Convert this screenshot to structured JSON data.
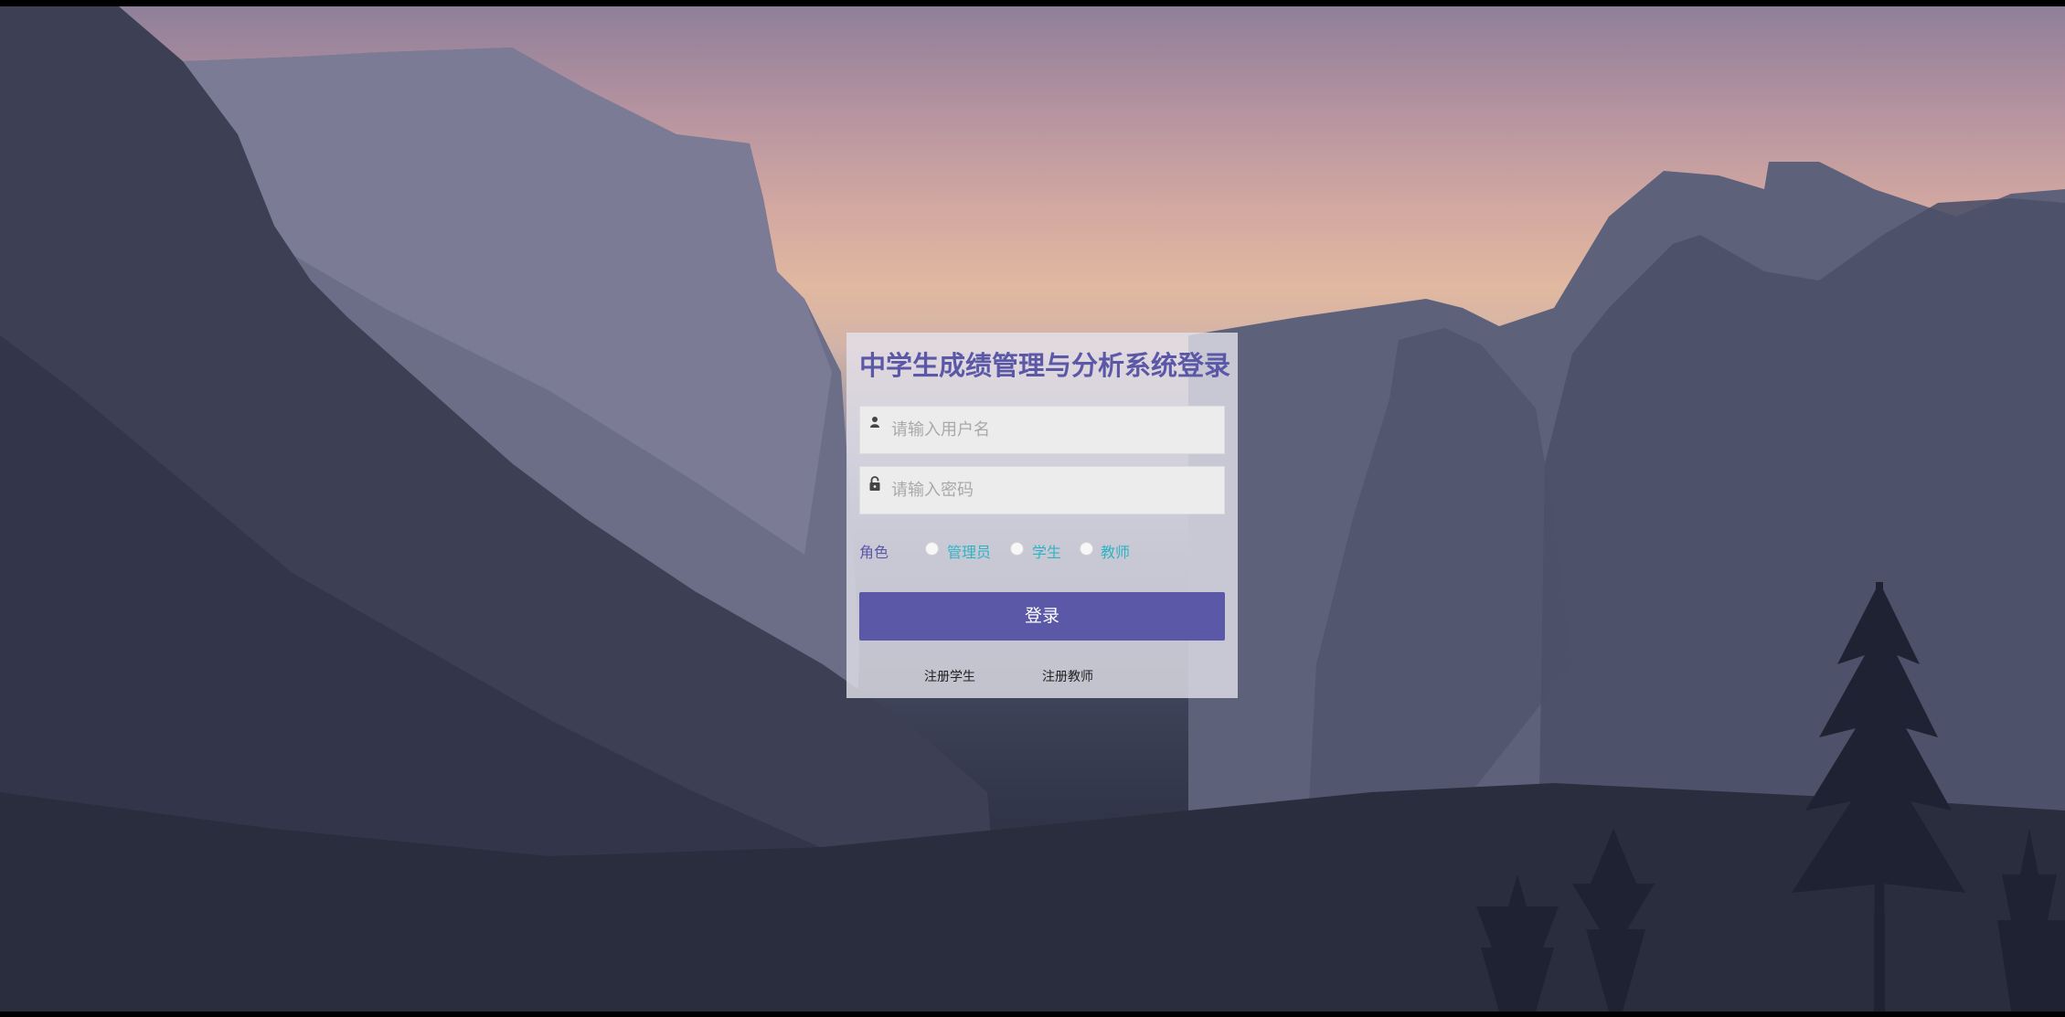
{
  "login": {
    "title": "中学生成绩管理与分析系统登录",
    "username_placeholder": "请输入用户名",
    "password_placeholder": "请输入密码",
    "role_label": "角色",
    "roles": [
      {
        "label": "管理员"
      },
      {
        "label": "学生"
      },
      {
        "label": "教师"
      }
    ],
    "login_button": "登录",
    "register_student": "注册学生",
    "register_teacher": "注册教师"
  },
  "icons": {
    "user": "user-icon",
    "lock": "lock-icon"
  },
  "colors": {
    "accent": "#5b58a8",
    "role_option": "#2fb3c4",
    "button_text": "#ffffff"
  }
}
